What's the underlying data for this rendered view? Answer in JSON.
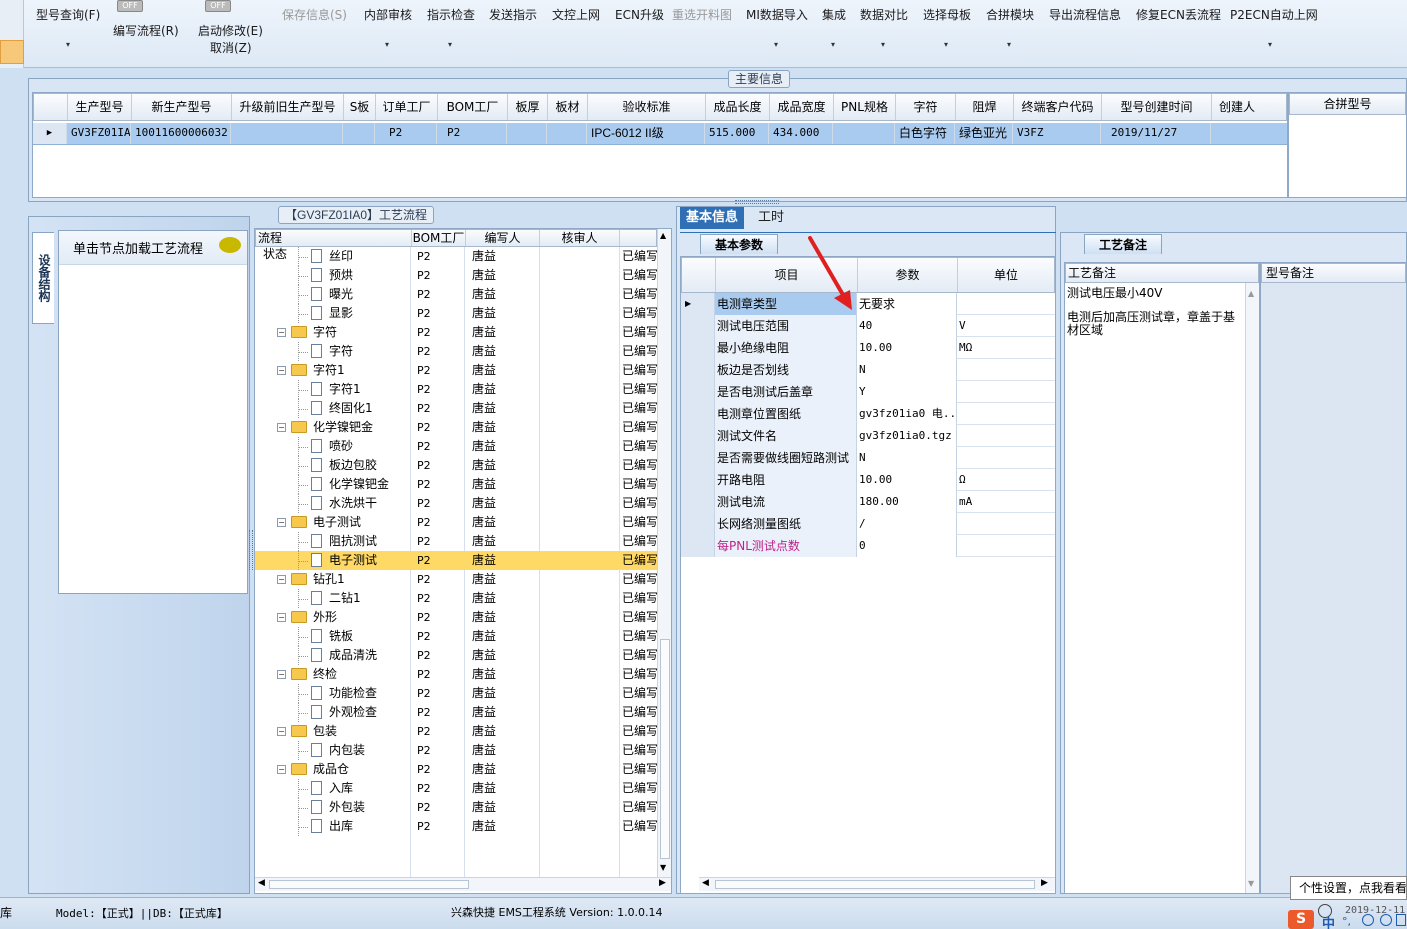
{
  "toolbar": {
    "items": [
      {
        "label": "型号查询(F)",
        "disabled": false
      },
      {
        "label": "编写流程(R)",
        "disabled": false
      },
      {
        "label": "启动修改(E)",
        "disabled": false
      },
      {
        "label": "取消(Z)",
        "disabled": false
      },
      {
        "label": "保存信息(S)",
        "disabled": true
      },
      {
        "label": "内部审核",
        "disabled": false
      },
      {
        "label": "指示检查",
        "disabled": false
      },
      {
        "label": "发送指示",
        "disabled": false
      },
      {
        "label": "文控上网",
        "disabled": false
      },
      {
        "label": "ECN升级",
        "disabled": false
      },
      {
        "label": "重选开料图",
        "disabled": true
      },
      {
        "label": "MI数据导入",
        "disabled": false
      },
      {
        "label": "集成",
        "disabled": false
      },
      {
        "label": "数据对比",
        "disabled": false
      },
      {
        "label": "选择母板",
        "disabled": false
      },
      {
        "label": "合拼模块",
        "disabled": false
      },
      {
        "label": "导出流程信息",
        "disabled": false
      },
      {
        "label": "修复ECN丢流程",
        "disabled": false
      },
      {
        "label": "P2ECN自动上网",
        "disabled": false
      }
    ],
    "toggle_text": "OFF"
  },
  "main_info": {
    "title": "主要信息",
    "columns": [
      "生产型号",
      "新生产型号",
      "升级前旧生产型号",
      "S板",
      "订单工厂",
      "BOM工厂",
      "板厚",
      "板材",
      "验收标准",
      "成品长度",
      "成品宽度",
      "PNL规格",
      "字符",
      "阻焊",
      "终端客户代码",
      "型号创建时间",
      "创建人"
    ],
    "row": [
      "GV3FZ01IA0",
      "10011600006032",
      "",
      "",
      "P2",
      "P2",
      "",
      "",
      "IPC-6012 II级",
      "515.000",
      "434.000",
      "",
      "白色字符",
      "绿色亚光",
      "V3FZ",
      "2019/11/27",
      ""
    ],
    "side_header": "合拼型号"
  },
  "left_panel": {
    "vertical_tab": "设备结构",
    "hint": "单击节点加载工艺流程"
  },
  "flow": {
    "title": "【GV3FZ01IA0】工艺流程",
    "columns": [
      "流程",
      "BOM工厂",
      "编写人",
      "核审人",
      "状态"
    ],
    "rows": [
      {
        "label": "丝印",
        "level": 2,
        "folder": false,
        "bom": "P2",
        "author": "唐益",
        "status": "已编写"
      },
      {
        "label": "预烘",
        "level": 2,
        "folder": false,
        "bom": "P2",
        "author": "唐益",
        "status": "已编写"
      },
      {
        "label": "曝光",
        "level": 2,
        "folder": false,
        "bom": "P2",
        "author": "唐益",
        "status": "已编写"
      },
      {
        "label": "显影",
        "level": 2,
        "folder": false,
        "bom": "P2",
        "author": "唐益",
        "status": "已编写"
      },
      {
        "label": "字符",
        "level": 1,
        "folder": true,
        "bom": "P2",
        "author": "唐益",
        "status": "已编写"
      },
      {
        "label": "字符",
        "level": 2,
        "folder": false,
        "bom": "P2",
        "author": "唐益",
        "status": "已编写"
      },
      {
        "label": "字符1",
        "level": 1,
        "folder": true,
        "bom": "P2",
        "author": "唐益",
        "status": "已编写"
      },
      {
        "label": "字符1",
        "level": 2,
        "folder": false,
        "bom": "P2",
        "author": "唐益",
        "status": "已编写"
      },
      {
        "label": "终固化1",
        "level": 2,
        "folder": false,
        "bom": "P2",
        "author": "唐益",
        "status": "已编写"
      },
      {
        "label": "化学镍钯金",
        "level": 1,
        "folder": true,
        "bom": "P2",
        "author": "唐益",
        "status": "已编写"
      },
      {
        "label": "喷砂",
        "level": 2,
        "folder": false,
        "bom": "P2",
        "author": "唐益",
        "status": "已编写"
      },
      {
        "label": "板边包胶",
        "level": 2,
        "folder": false,
        "bom": "P2",
        "author": "唐益",
        "status": "已编写"
      },
      {
        "label": "化学镍钯金",
        "level": 2,
        "folder": false,
        "bom": "P2",
        "author": "唐益",
        "status": "已编写"
      },
      {
        "label": "水洗烘干",
        "level": 2,
        "folder": false,
        "bom": "P2",
        "author": "唐益",
        "status": "已编写"
      },
      {
        "label": "电子测试",
        "level": 1,
        "folder": true,
        "bom": "P2",
        "author": "唐益",
        "status": "已编写"
      },
      {
        "label": "阻抗测试",
        "level": 2,
        "folder": false,
        "bom": "P2",
        "author": "唐益",
        "status": "已编写"
      },
      {
        "label": "电子测试",
        "level": 2,
        "folder": false,
        "bom": "P2",
        "author": "唐益",
        "status": "已编写",
        "selected": true
      },
      {
        "label": "钻孔1",
        "level": 1,
        "folder": true,
        "bom": "P2",
        "author": "唐益",
        "status": "已编写"
      },
      {
        "label": "二钻1",
        "level": 2,
        "folder": false,
        "bom": "P2",
        "author": "唐益",
        "status": "已编写"
      },
      {
        "label": "外形",
        "level": 1,
        "folder": true,
        "bom": "P2",
        "author": "唐益",
        "status": "已编写"
      },
      {
        "label": "铣板",
        "level": 2,
        "folder": false,
        "bom": "P2",
        "author": "唐益",
        "status": "已编写"
      },
      {
        "label": "成品清洗",
        "level": 2,
        "folder": false,
        "bom": "P2",
        "author": "唐益",
        "status": "已编写"
      },
      {
        "label": "终检",
        "level": 1,
        "folder": true,
        "bom": "P2",
        "author": "唐益",
        "status": "已编写"
      },
      {
        "label": "功能检查",
        "level": 2,
        "folder": false,
        "bom": "P2",
        "author": "唐益",
        "status": "已编写"
      },
      {
        "label": "外观检查",
        "level": 2,
        "folder": false,
        "bom": "P2",
        "author": "唐益",
        "status": "已编写"
      },
      {
        "label": "包装",
        "level": 1,
        "folder": true,
        "bom": "P2",
        "author": "唐益",
        "status": "已编写"
      },
      {
        "label": "内包装",
        "level": 2,
        "folder": false,
        "bom": "P2",
        "author": "唐益",
        "status": "已编写"
      },
      {
        "label": "成品仓",
        "level": 1,
        "folder": true,
        "bom": "P2",
        "author": "唐益",
        "status": "已编写"
      },
      {
        "label": "入库",
        "level": 2,
        "folder": false,
        "bom": "P2",
        "author": "唐益",
        "status": "已编写"
      },
      {
        "label": "外包装",
        "level": 2,
        "folder": false,
        "bom": "P2",
        "author": "唐益",
        "status": "已编写"
      },
      {
        "label": "出库",
        "level": 2,
        "folder": false,
        "bom": "P2",
        "author": "唐益",
        "status": "已编写"
      }
    ]
  },
  "detail": {
    "tabs": [
      "基本信息",
      "工时"
    ],
    "subtab": "基本参数",
    "columns": [
      "项目",
      "参数",
      "单位"
    ],
    "rows": [
      {
        "k": "电测章类型",
        "v": "无要求",
        "u": "",
        "current": true
      },
      {
        "k": "测试电压范围",
        "v": "40",
        "u": "V"
      },
      {
        "k": "最小绝缘电阻",
        "v": "10.00",
        "u": "MΩ"
      },
      {
        "k": "板边是否划线",
        "v": "N",
        "u": ""
      },
      {
        "k": "是否电测试后盖章",
        "v": "Y",
        "u": ""
      },
      {
        "k": "电测章位置图纸",
        "v": "gv3fz01ia0 电...",
        "u": ""
      },
      {
        "k": "测试文件名",
        "v": "gv3fz01ia0.tgz",
        "u": ""
      },
      {
        "k": "是否需要做线圈短路测试",
        "v": "N",
        "u": ""
      },
      {
        "k": "开路电阻",
        "v": "10.00",
        "u": "Ω"
      },
      {
        "k": "测试电流",
        "v": "180.00",
        "u": "mA"
      },
      {
        "k": "长网络测量图纸",
        "v": "/",
        "u": ""
      },
      {
        "k": "每PNL测试点数",
        "v": "0",
        "u": "",
        "highlight": true
      }
    ]
  },
  "remarks": {
    "tab": "工艺备注",
    "col1": "工艺备注",
    "col2": "型号备注",
    "text1": "测试电压最小40V",
    "text2": "电测后加高压测试章，章盖于基材区域"
  },
  "status": {
    "left_frag": "库",
    "model": "Model:【正式】||DB:【正式库】",
    "app": "兴森快捷 EMS工程系统 Version: 1.0.0.14",
    "tooltip": "个性设置，点我看看",
    "date": "2019-12-11",
    "ime": "中"
  },
  "colors": {
    "selected_row": "#ffd966",
    "accent_tab": "#2f6fb5",
    "arrow": "#e02020"
  }
}
